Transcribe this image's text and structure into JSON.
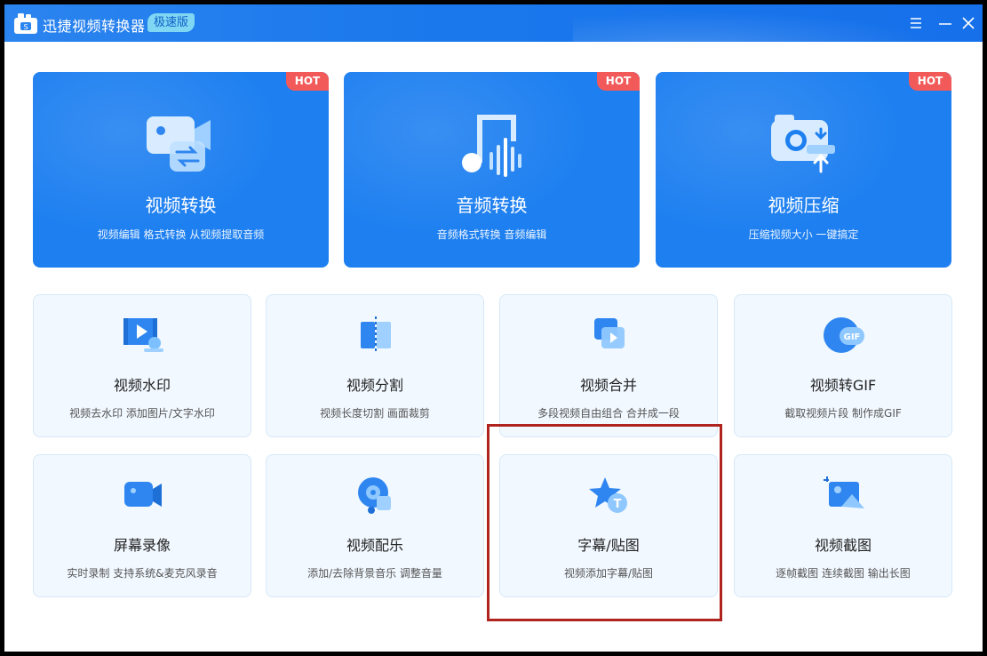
{
  "app": {
    "title": "迅捷视频转换器",
    "edition": "极速版"
  },
  "colors": {
    "titlebar": "#1a78ec",
    "card_blue": "#1d7ff0",
    "hot_badge": "#f25a5a",
    "tool_bg": "#f1f8ff",
    "highlight": "#b0241f"
  },
  "hot_cards": [
    {
      "title": "视频转换",
      "desc": "视频编辑 格式转换 从视频提取音频",
      "badge": "HOT",
      "icon": "video-convert-icon"
    },
    {
      "title": "音频转换",
      "desc": "音频格式转换 音频编辑",
      "badge": "HOT",
      "icon": "audio-convert-icon"
    },
    {
      "title": "视频压缩",
      "desc": "压缩视频大小 一键搞定",
      "badge": "HOT",
      "icon": "video-compress-icon"
    }
  ],
  "tools": [
    {
      "title": "视频水印",
      "desc": "视频去水印 添加图片/文字水印",
      "icon": "watermark-icon"
    },
    {
      "title": "视频分割",
      "desc": "视频长度切割 画面裁剪",
      "icon": "split-icon"
    },
    {
      "title": "视频合并",
      "desc": "多段视频自由组合 合并成一段",
      "icon": "merge-icon"
    },
    {
      "title": "视频转GIF",
      "desc": "截取视频片段 制作成GIF",
      "icon": "gif-icon",
      "icon_text": "GIF"
    },
    {
      "title": "屏幕录像",
      "desc": "实时录制 支持系统&麦克风录音",
      "icon": "screen-record-icon"
    },
    {
      "title": "视频配乐",
      "desc": "添加/去除背景音乐 调整音量",
      "icon": "music-icon"
    },
    {
      "title": "字幕/贴图",
      "desc": "视频添加字幕/贴图",
      "icon": "subtitle-sticker-icon",
      "icon_text": "T"
    },
    {
      "title": "视频截图",
      "desc": "逐帧截图 连续截图 输出长图",
      "icon": "screenshot-icon"
    }
  ]
}
